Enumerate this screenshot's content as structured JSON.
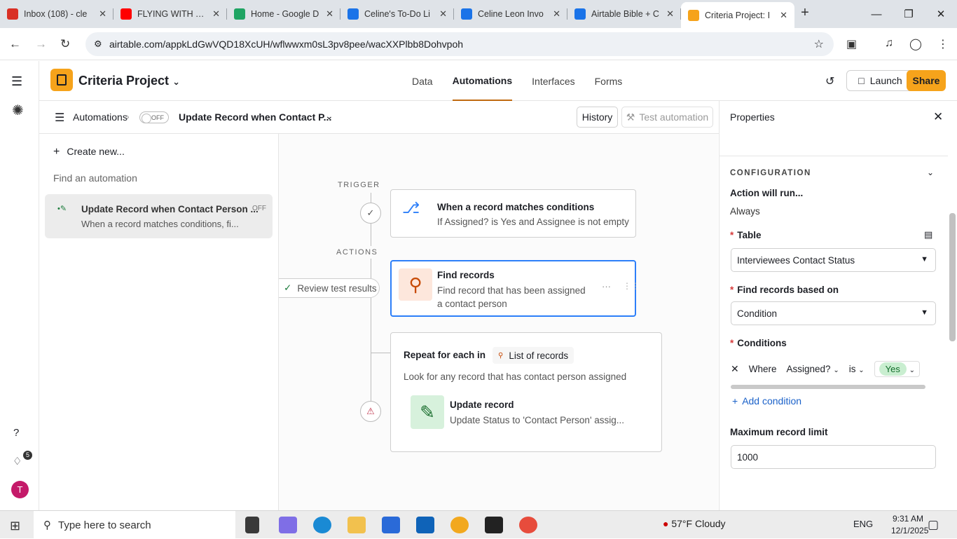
{
  "browser": {
    "tabs": [
      {
        "title": "Inbox (108) - cle",
        "color": "#d93025"
      },
      {
        "title": "FLYING WITH TH",
        "color": "#ff0000"
      },
      {
        "title": "Home - Google D",
        "color": "#1fa463"
      },
      {
        "title": "Celine's To-Do Li",
        "color": "#1a73e8"
      },
      {
        "title": "Celine Leon Invo",
        "color": "#1a73e8"
      },
      {
        "title": "Airtable Bible + C",
        "color": "#1a73e8"
      },
      {
        "title": "Criteria Project: I",
        "color": "#f6a31b"
      }
    ],
    "url": "airtable.com/appkLdGwVQD18XcUH/wflwwxm0sL3pv8pee/wacXXPlbb8Dohvpoh"
  },
  "header": {
    "base_name": "Criteria Project",
    "tabs": [
      "Data",
      "Automations",
      "Interfaces",
      "Forms"
    ],
    "active_tab": "Automations",
    "launch_label": "Launch",
    "share_label": "Share"
  },
  "subheader": {
    "crumb": "Automations",
    "toggle": "OFF",
    "automation_name": "Update Record when Contact P...",
    "history_label": "History",
    "test_label": "Test automation"
  },
  "sidebar": {
    "create_label": "Create new...",
    "search_placeholder": "Find an automation",
    "item_title": "Update Record when Contact Person ...",
    "item_desc": "When a record matches conditions, fi...",
    "item_status": "OFF"
  },
  "canvas": {
    "trigger_label": "TRIGGER",
    "actions_label": "ACTIONS",
    "trigger_title": "When a record matches conditions",
    "trigger_desc": "If Assigned? is Yes and Assignee is not empty",
    "review_label": "Review test results",
    "find_title": "Find records",
    "find_desc1": "Find record that has been assigned",
    "find_desc2": "a contact person",
    "repeat_title": "Repeat for each in",
    "repeat_list": "List of records",
    "repeat_desc": "Look for any record that has contact person assigned",
    "update_title": "Update record",
    "update_desc": "Update Status to 'Contact Person' assig..."
  },
  "properties": {
    "title": "Properties",
    "section": "CONFIGURATION",
    "will_run_label": "Action will run...",
    "will_run_value": "Always",
    "table_label": "Table",
    "table_value": "Interviewees Contact Status",
    "find_based_label": "Find records based on",
    "find_based_value": "Condition",
    "conditions_label": "Conditions",
    "cond_where": "Where",
    "cond_field": "Assigned?",
    "cond_op": "is",
    "cond_value": "Yes",
    "add_condition": "Add condition",
    "max_label": "Maximum record limit",
    "max_value": "1000"
  },
  "taskbar": {
    "search_placeholder": "Type here to search",
    "weather": "57°F  Cloudy",
    "lang": "ENG",
    "time": "9:31 AM",
    "date": "12/1/2025",
    "notification_count": "5"
  },
  "rail": {
    "avatar": "T"
  }
}
